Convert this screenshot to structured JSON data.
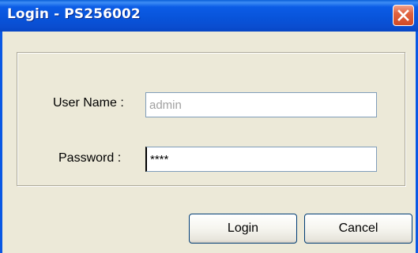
{
  "window": {
    "title": "Login - PS256002"
  },
  "form": {
    "username_label": "User Name :",
    "username_value": "admin",
    "password_label": "Password :",
    "password_value": "****"
  },
  "buttons": {
    "login_label": "Login",
    "cancel_label": "Cancel"
  },
  "icons": {
    "close": "close-icon"
  },
  "colors": {
    "titlebar": "#0853d9",
    "close_button": "#e0623f",
    "dialog_background": "#ece9d8"
  }
}
